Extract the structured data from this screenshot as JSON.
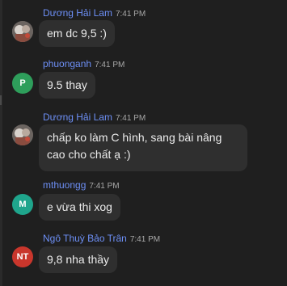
{
  "messages": [
    {
      "sender": "Dương Hải Lam",
      "time": "7:41 PM",
      "avatar_initials": "",
      "avatar_color": "#5a5a5a",
      "text": "em dc 9,5 :)"
    },
    {
      "sender": "phuonganh",
      "time": "7:41 PM",
      "avatar_initials": "P",
      "avatar_color": "#2e9e5b",
      "text": "9.5 thay"
    },
    {
      "sender": "Dương Hải Lam",
      "time": "7:41 PM",
      "avatar_initials": "",
      "avatar_color": "#5a5a5a",
      "text": "chấp ko làm C hình, sang bài nâng cao cho chất ạ :)"
    },
    {
      "sender": "mthuongg",
      "time": "7:41 PM",
      "avatar_initials": "M",
      "avatar_color": "#1fa58c",
      "text": "e vừa thi xog"
    },
    {
      "sender": "Ngô Thuỳ Bảo Trân",
      "time": "7:41 PM",
      "avatar_initials": "NT",
      "avatar_color": "#c9362c",
      "text": "9,8 nha thầy"
    }
  ],
  "colors": {
    "background": "#1f1f1f",
    "bubble": "#2f2f2f",
    "sender_name": "#6d8ff5",
    "timestamp": "#a8a8a8",
    "message_text": "#ececec"
  }
}
